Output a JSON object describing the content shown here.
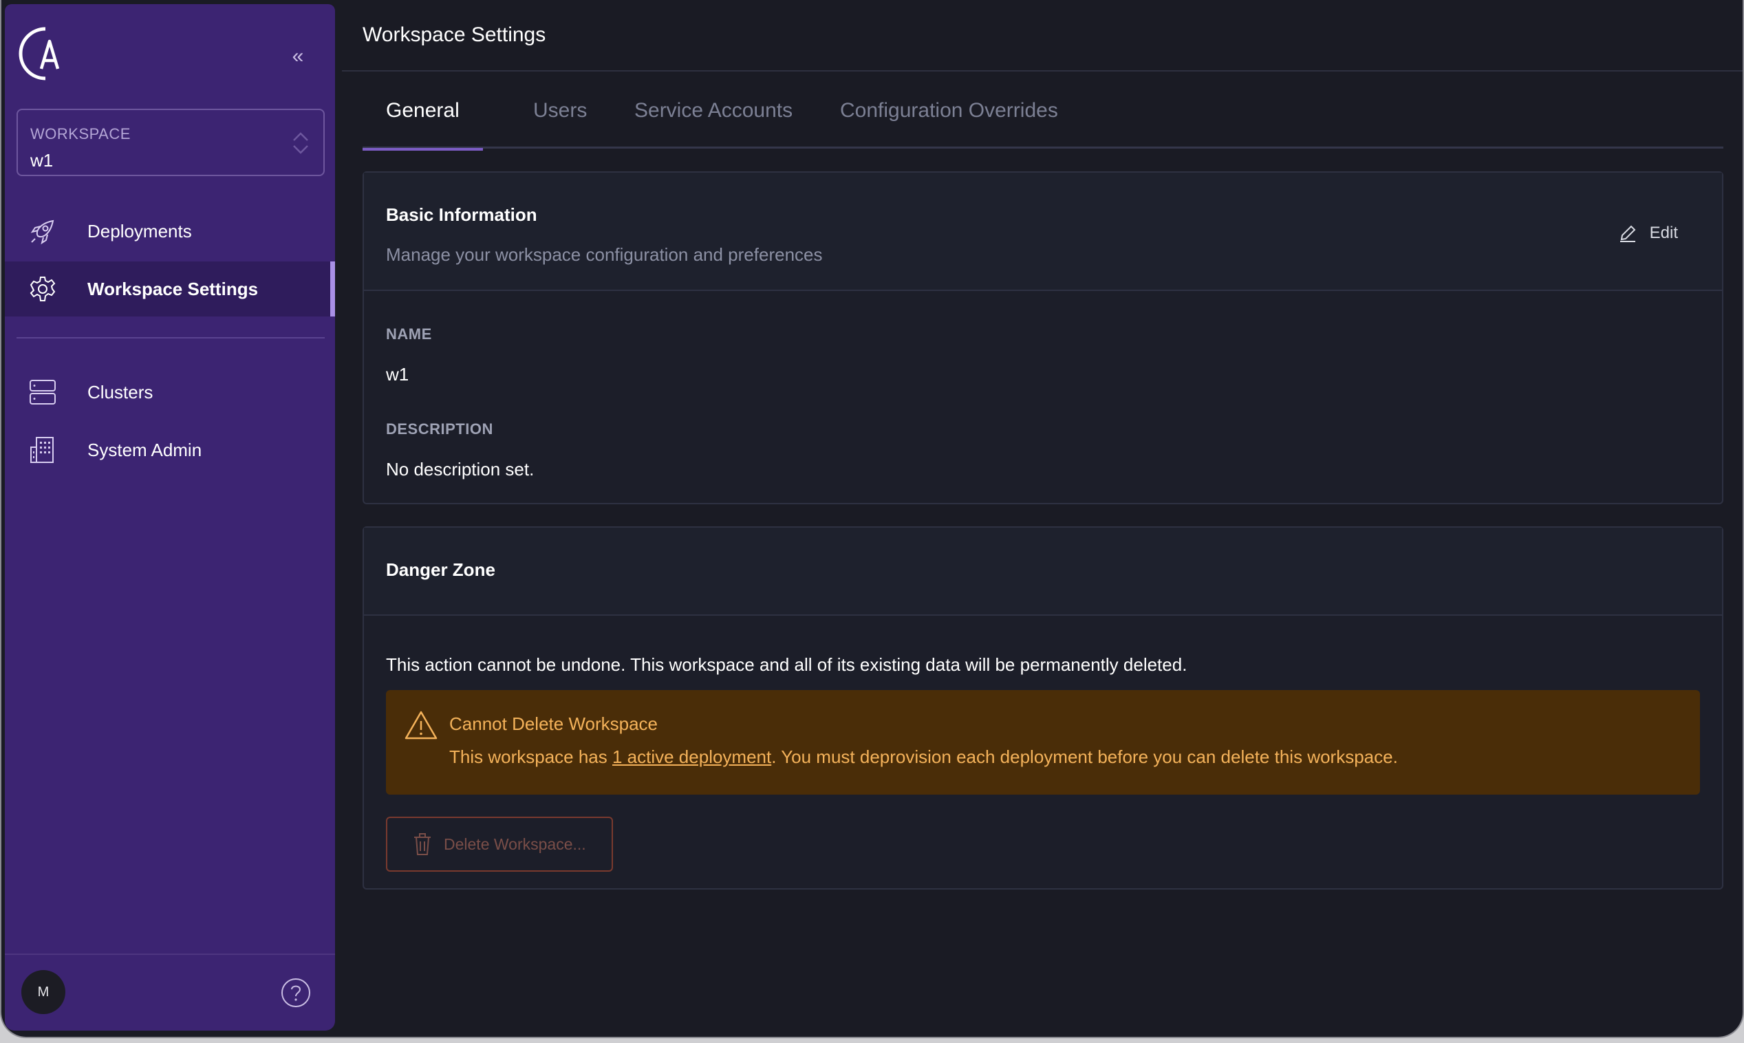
{
  "sidebar": {
    "workspace_label": "WORKSPACE",
    "workspace_value": "w1",
    "nav": [
      {
        "label": "Deployments",
        "icon": "rocket-icon"
      },
      {
        "label": "Workspace Settings",
        "icon": "gear-icon",
        "active": true
      },
      {
        "label": "Clusters",
        "icon": "server-icon"
      },
      {
        "label": "System Admin",
        "icon": "building-icon"
      }
    ],
    "avatar_initial": "M"
  },
  "header": {
    "title": "Workspace Settings"
  },
  "tabs": [
    {
      "label": "General",
      "active": true
    },
    {
      "label": "Users"
    },
    {
      "label": "Service Accounts"
    },
    {
      "label": "Configuration Overrides"
    }
  ],
  "basic_info": {
    "title": "Basic Information",
    "subtitle": "Manage your workspace configuration and preferences",
    "edit_label": "Edit",
    "name_label": "NAME",
    "name_value": "w1",
    "description_label": "DESCRIPTION",
    "description_value": "No description set."
  },
  "danger_zone": {
    "title": "Danger Zone",
    "text": "This action cannot be undone. This workspace and all of its existing data will be permanently deleted.",
    "alert_title": "Cannot Delete Workspace",
    "alert_prefix": "This workspace has ",
    "alert_link": "1 active deployment",
    "alert_suffix": ". You must deprovision each deployment before you can delete this workspace.",
    "delete_label": "Delete Workspace..."
  },
  "colors": {
    "sidebar_bg": "#3c2472",
    "sidebar_active": "#2f1c5c",
    "accent": "#7c5cc4",
    "page_bg": "#1a1b24",
    "warning_bg": "#4a2d08",
    "warning_text": "#f4b25a"
  }
}
